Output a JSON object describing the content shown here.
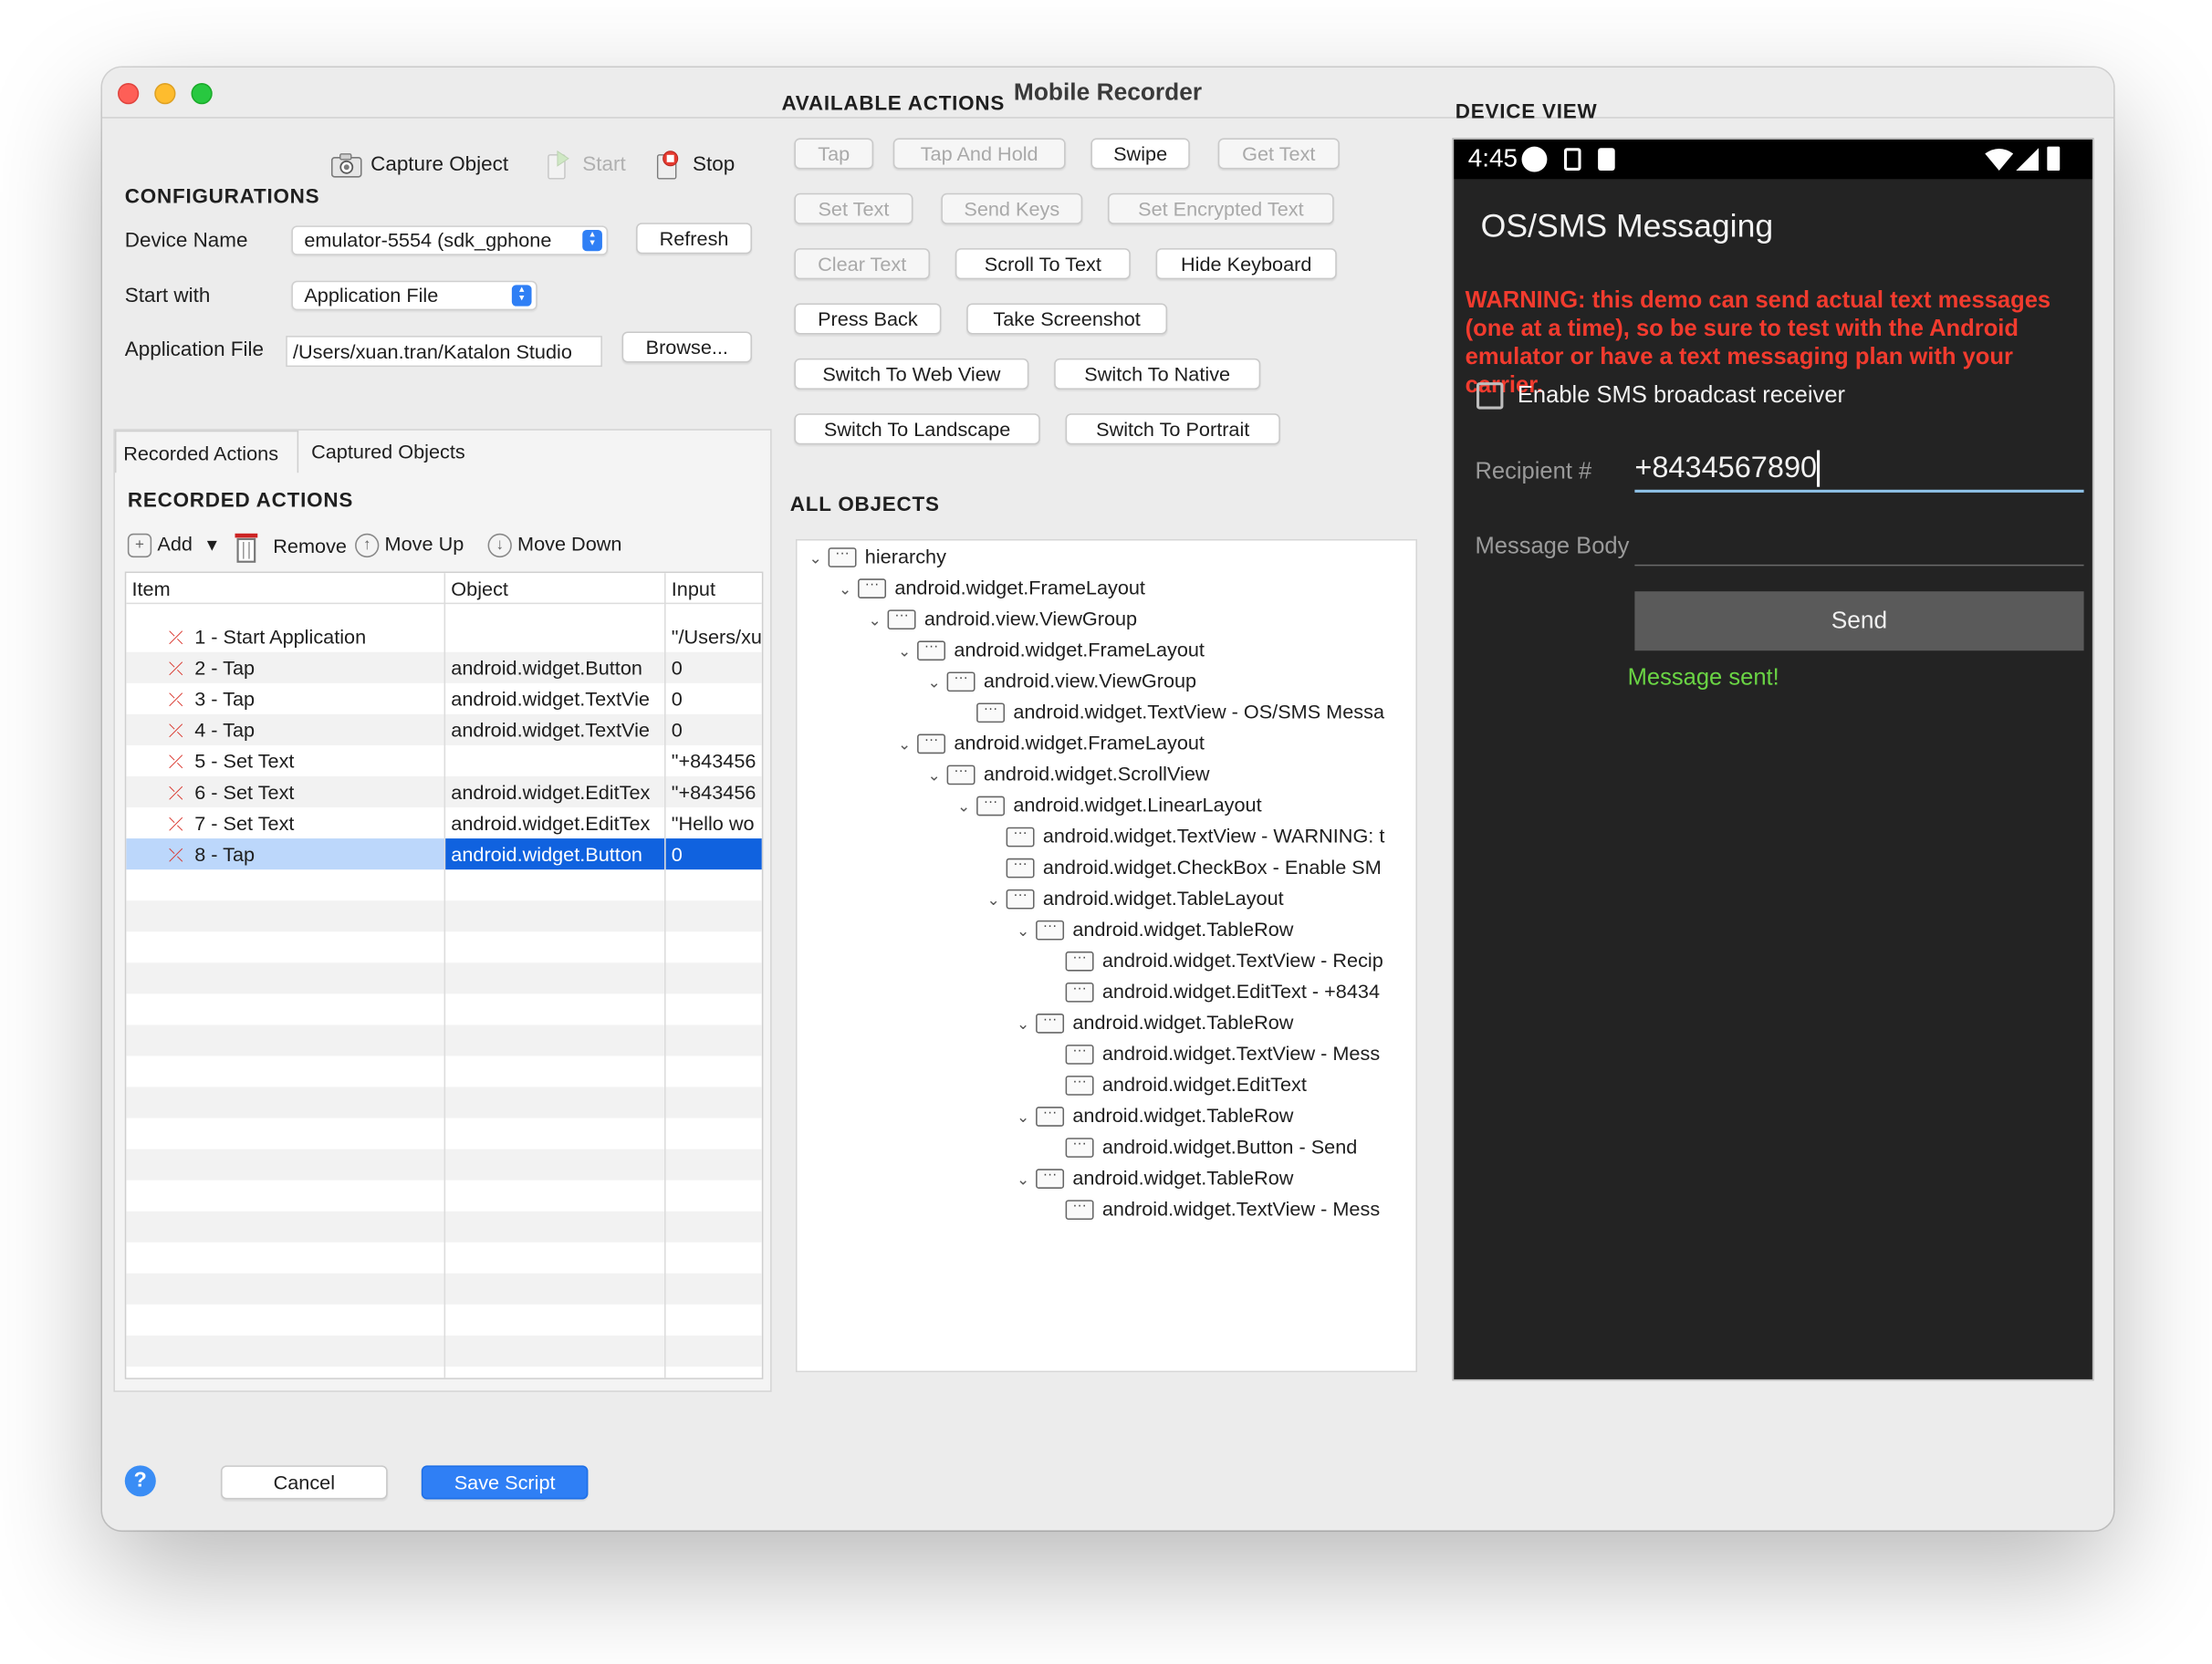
{
  "window": {
    "title": "Mobile Recorder"
  },
  "toolbar": {
    "capture_label": "Capture Object",
    "start_label": "Start",
    "stop_label": "Stop"
  },
  "config": {
    "heading": "CONFIGURATIONS",
    "device_name_label": "Device Name",
    "device_name_value": "emulator-5554 (sdk_gphone",
    "refresh_label": "Refresh",
    "start_with_label": "Start with",
    "start_with_value": "Application File",
    "app_file_label": "Application File",
    "app_file_value": "/Users/xuan.tran/Katalon Studio",
    "browse_label": "Browse..."
  },
  "tabs": {
    "recorded": "Recorded Actions",
    "captured": "Captured Objects"
  },
  "recorded": {
    "heading": "RECORDED ACTIONS",
    "add": "Add",
    "remove": "Remove",
    "move_up": "Move Up",
    "move_down": "Move Down",
    "columns": [
      "Item",
      "Object",
      "Input"
    ],
    "rows": [
      {
        "item": "1 - Start Application",
        "object": "",
        "input": "\"/Users/xu"
      },
      {
        "item": "2 - Tap",
        "object": "android.widget.Button",
        "input": "0"
      },
      {
        "item": "3 - Tap",
        "object": "android.widget.TextVie",
        "input": "0"
      },
      {
        "item": "4 - Tap",
        "object": "android.widget.TextVie",
        "input": "0"
      },
      {
        "item": "5 - Set Text",
        "object": "",
        "input": "\"+843456"
      },
      {
        "item": "6 - Set Text",
        "object": "android.widget.EditTex",
        "input": "\"+843456"
      },
      {
        "item": "7 - Set Text",
        "object": "android.widget.EditTex",
        "input": "\"Hello wo"
      },
      {
        "item": "8 - Tap",
        "object": "android.widget.Button",
        "input": "0"
      }
    ]
  },
  "actions": {
    "heading": "AVAILABLE ACTIONS",
    "tap": "Tap",
    "tap_hold": "Tap And Hold",
    "swipe": "Swipe",
    "get_text": "Get Text",
    "set_text": "Set Text",
    "send_keys": "Send Keys",
    "set_encrypted": "Set Encrypted Text",
    "clear_text": "Clear Text",
    "scroll_to_text": "Scroll To Text",
    "hide_keyboard": "Hide Keyboard",
    "press_back": "Press Back",
    "take_screenshot": "Take Screenshot",
    "switch_web": "Switch To Web View",
    "switch_native": "Switch To Native",
    "switch_landscape": "Switch To Landscape",
    "switch_portrait": "Switch To Portrait"
  },
  "objects": {
    "heading": "ALL OBJECTS",
    "nodes": [
      {
        "label": "hierarchy",
        "expanded": true
      },
      {
        "label": "android.widget.FrameLayout",
        "expanded": true
      },
      {
        "label": "android.view.ViewGroup",
        "expanded": true
      },
      {
        "label": "android.widget.FrameLayout",
        "expanded": true
      },
      {
        "label": "android.view.ViewGroup",
        "expanded": true
      },
      {
        "label": "android.widget.TextView - OS/SMS Messa",
        "expanded": false
      },
      {
        "label": "android.widget.FrameLayout",
        "expanded": true
      },
      {
        "label": "android.widget.ScrollView",
        "expanded": true
      },
      {
        "label": "android.widget.LinearLayout",
        "expanded": true
      },
      {
        "label": "android.widget.TextView - WARNING: t",
        "expanded": false
      },
      {
        "label": "android.widget.CheckBox - Enable SM",
        "expanded": false
      },
      {
        "label": "android.widget.TableLayout",
        "expanded": true
      },
      {
        "label": "android.widget.TableRow",
        "expanded": true
      },
      {
        "label": "android.widget.TextView - Recip",
        "expanded": false
      },
      {
        "label": "android.widget.EditText - +8434",
        "expanded": false
      },
      {
        "label": "android.widget.TableRow",
        "expanded": true
      },
      {
        "label": "android.widget.TextView - Mess",
        "expanded": false
      },
      {
        "label": "android.widget.EditText",
        "expanded": false
      },
      {
        "label": "android.widget.TableRow",
        "expanded": true
      },
      {
        "label": "android.widget.Button - Send",
        "expanded": false
      },
      {
        "label": "android.widget.TableRow",
        "expanded": true
      },
      {
        "label": "android.widget.TextView - Mess",
        "expanded": false
      }
    ]
  },
  "device": {
    "heading": "DEVICE VIEW",
    "time": "4:45",
    "app_title": "OS/SMS Messaging",
    "warning": "WARNING: this demo can send actual text messages (one at a time), so be sure to test with the Android emulator or have a text messaging plan with your carrier.",
    "checkbox_label": "Enable SMS broadcast receiver",
    "recipient_label": "Recipient #",
    "recipient_value": "+8434567890",
    "message_label": "Message Body",
    "message_value": "",
    "send_label": "Send",
    "sent_text": "Message sent!"
  },
  "footer": {
    "help": "?",
    "cancel": "Cancel",
    "save": "Save Script"
  },
  "colors": {
    "accent": "#2f7ff5",
    "warning": "#f23b2e",
    "success": "#6ad444",
    "selection": "#1062df"
  }
}
